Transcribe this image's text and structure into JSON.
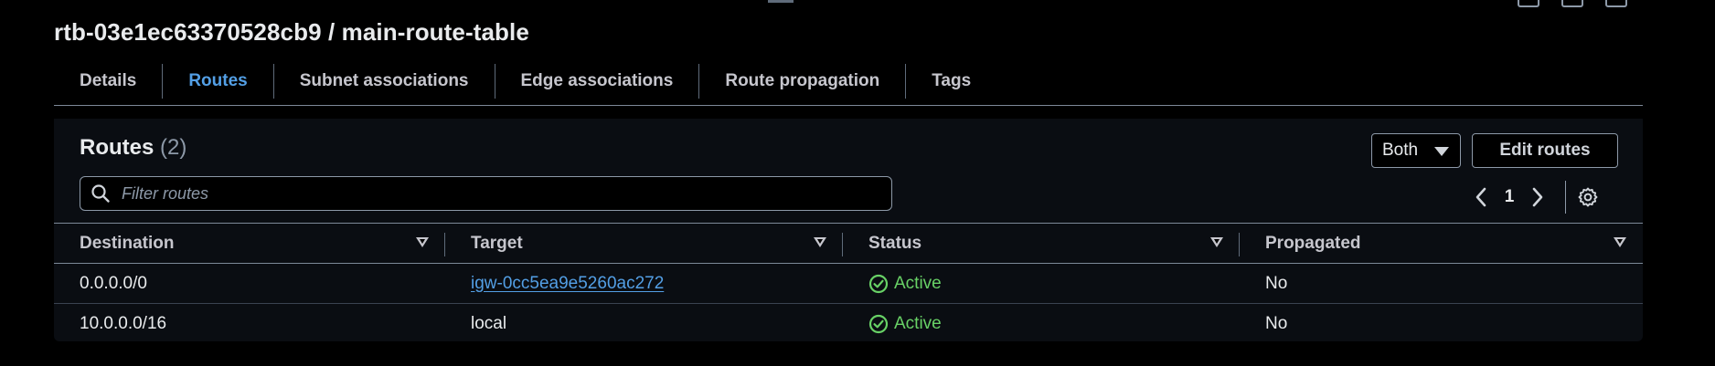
{
  "header": {
    "title": "rtb-03e1ec63370528cb9 / main-route-table"
  },
  "tabs": [
    {
      "label": "Details",
      "active": false
    },
    {
      "label": "Routes",
      "active": true
    },
    {
      "label": "Subnet associations",
      "active": false
    },
    {
      "label": "Edge associations",
      "active": false
    },
    {
      "label": "Route propagation",
      "active": false
    },
    {
      "label": "Tags",
      "active": false
    }
  ],
  "routes": {
    "title": "Routes",
    "count": "(2)",
    "filter_placeholder": "Filter routes",
    "select_value": "Both",
    "edit_label": "Edit routes",
    "page_number": "1",
    "columns": [
      "Destination",
      "Target",
      "Status",
      "Propagated"
    ],
    "rows": [
      {
        "destination": "0.0.0.0/0",
        "target": "igw-0cc5ea9e5260ac272",
        "target_is_link": true,
        "status": "Active",
        "propagated": "No"
      },
      {
        "destination": "10.0.0.0/16",
        "target": "local",
        "target_is_link": false,
        "status": "Active",
        "propagated": "No"
      }
    ]
  },
  "colors": {
    "background": "#000000",
    "accent": "#539fe5",
    "success": "#68d166",
    "border": "#7d8998"
  },
  "icons": {
    "search": "search-icon",
    "prev": "chevron-left-icon",
    "next": "chevron-right-icon",
    "settings": "gear-icon",
    "status": "check-circle-icon",
    "sort": "caret-down-icon"
  }
}
